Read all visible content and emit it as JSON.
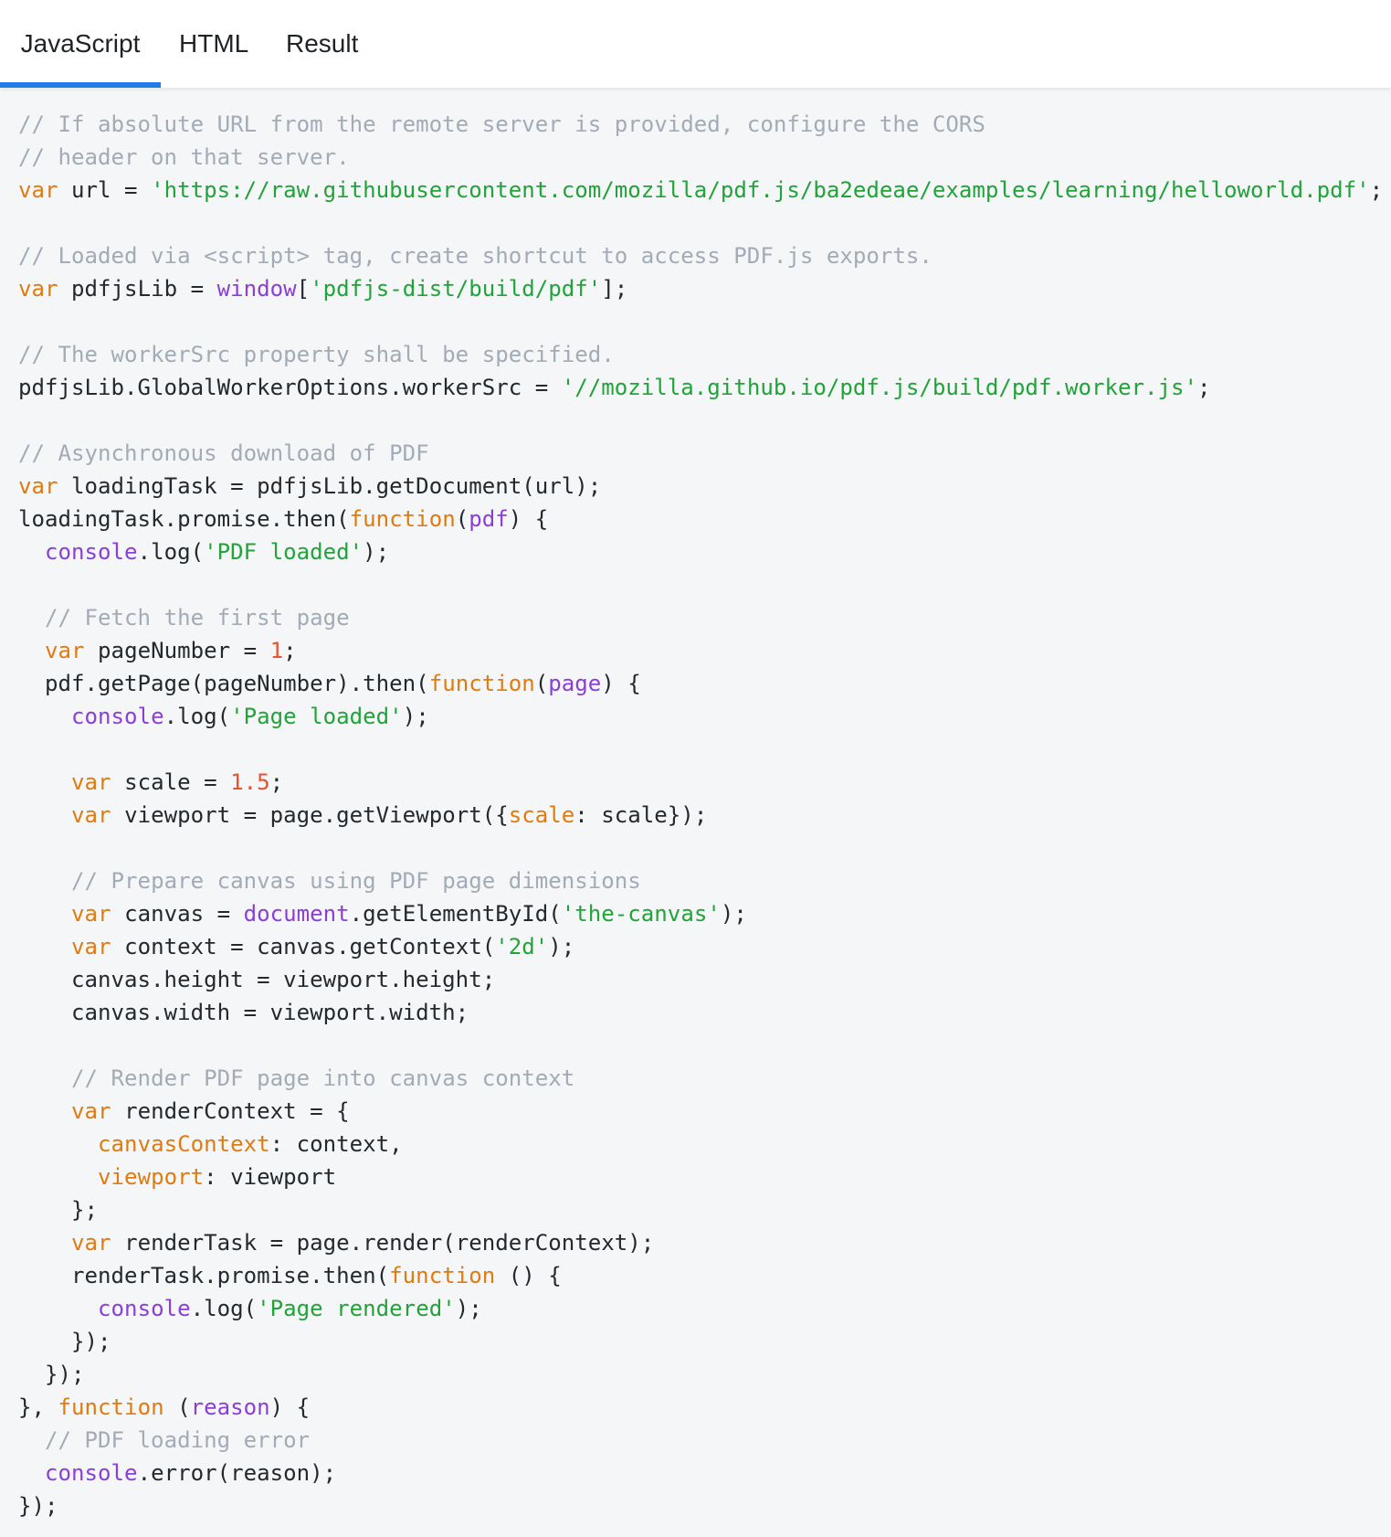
{
  "tabs": [
    {
      "label": "JavaScript",
      "active": true
    },
    {
      "label": "HTML",
      "active": false
    },
    {
      "label": "Result",
      "active": false
    }
  ],
  "colors": {
    "active_tab_underline": "#1e7ee6",
    "code_background": "#f5f6f8",
    "comment": "#a2abb6",
    "keyword": "#e07b10",
    "string": "#22a33a",
    "builtin": "#8b3fd6",
    "number": "#e8532b",
    "plain": "#24292e"
  },
  "code_lines": [
    [
      [
        "c",
        "// If absolute URL from the remote server is provided, configure the CORS"
      ]
    ],
    [
      [
        "c",
        "// header on that server."
      ]
    ],
    [
      [
        "k",
        "var"
      ],
      [
        "x",
        " url = "
      ],
      [
        "s",
        "'https://raw.githubusercontent.com/mozilla/pdf.js/ba2edeae/examples/learning/helloworld.pdf'"
      ],
      [
        "x",
        ";"
      ]
    ],
    [],
    [
      [
        "c",
        "// Loaded via <script> tag, create shortcut to access PDF.js exports."
      ]
    ],
    [
      [
        "k",
        "var"
      ],
      [
        "x",
        " pdfjsLib = "
      ],
      [
        "p",
        "window"
      ],
      [
        "x",
        "["
      ],
      [
        "s",
        "'pdfjs-dist/build/pdf'"
      ],
      [
        "x",
        "];"
      ]
    ],
    [],
    [
      [
        "c",
        "// The workerSrc property shall be specified."
      ]
    ],
    [
      [
        "x",
        "pdfjsLib.GlobalWorkerOptions.workerSrc = "
      ],
      [
        "s",
        "'//mozilla.github.io/pdf.js/build/pdf.worker.js'"
      ],
      [
        "x",
        ";"
      ]
    ],
    [],
    [
      [
        "c",
        "// Asynchronous download of PDF"
      ]
    ],
    [
      [
        "k",
        "var"
      ],
      [
        "x",
        " loadingTask = pdfjsLib.getDocument(url);"
      ]
    ],
    [
      [
        "x",
        "loadingTask.promise.then("
      ],
      [
        "k",
        "function"
      ],
      [
        "x",
        "("
      ],
      [
        "p",
        "pdf"
      ],
      [
        "x",
        ") {"
      ]
    ],
    [
      [
        "x",
        "  "
      ],
      [
        "p",
        "console"
      ],
      [
        "x",
        ".log("
      ],
      [
        "s",
        "'PDF loaded'"
      ],
      [
        "x",
        ");"
      ]
    ],
    [],
    [
      [
        "x",
        "  "
      ],
      [
        "c",
        "// Fetch the first page"
      ]
    ],
    [
      [
        "x",
        "  "
      ],
      [
        "k",
        "var"
      ],
      [
        "x",
        " pageNumber = "
      ],
      [
        "n",
        "1"
      ],
      [
        "x",
        ";"
      ]
    ],
    [
      [
        "x",
        "  pdf.getPage(pageNumber).then("
      ],
      [
        "k",
        "function"
      ],
      [
        "x",
        "("
      ],
      [
        "p",
        "page"
      ],
      [
        "x",
        ") {"
      ]
    ],
    [
      [
        "x",
        "    "
      ],
      [
        "p",
        "console"
      ],
      [
        "x",
        ".log("
      ],
      [
        "s",
        "'Page loaded'"
      ],
      [
        "x",
        ");"
      ]
    ],
    [],
    [
      [
        "x",
        "    "
      ],
      [
        "k",
        "var"
      ],
      [
        "x",
        " scale = "
      ],
      [
        "n",
        "1.5"
      ],
      [
        "x",
        ";"
      ]
    ],
    [
      [
        "x",
        "    "
      ],
      [
        "k",
        "var"
      ],
      [
        "x",
        " viewport = page.getViewport({"
      ],
      [
        "o",
        "scale"
      ],
      [
        "x",
        ": scale});"
      ]
    ],
    [],
    [
      [
        "x",
        "    "
      ],
      [
        "c",
        "// Prepare canvas using PDF page dimensions"
      ]
    ],
    [
      [
        "x",
        "    "
      ],
      [
        "k",
        "var"
      ],
      [
        "x",
        " canvas = "
      ],
      [
        "p",
        "document"
      ],
      [
        "x",
        ".getElementById("
      ],
      [
        "s",
        "'the-canvas'"
      ],
      [
        "x",
        ");"
      ]
    ],
    [
      [
        "x",
        "    "
      ],
      [
        "k",
        "var"
      ],
      [
        "x",
        " context = canvas.getContext("
      ],
      [
        "s",
        "'2d'"
      ],
      [
        "x",
        ");"
      ]
    ],
    [
      [
        "x",
        "    canvas.height = viewport.height;"
      ]
    ],
    [
      [
        "x",
        "    canvas.width = viewport.width;"
      ]
    ],
    [],
    [
      [
        "x",
        "    "
      ],
      [
        "c",
        "// Render PDF page into canvas context"
      ]
    ],
    [
      [
        "x",
        "    "
      ],
      [
        "k",
        "var"
      ],
      [
        "x",
        " renderContext = {"
      ]
    ],
    [
      [
        "x",
        "      "
      ],
      [
        "o",
        "canvasContext"
      ],
      [
        "x",
        ": context,"
      ]
    ],
    [
      [
        "x",
        "      "
      ],
      [
        "o",
        "viewport"
      ],
      [
        "x",
        ": viewport"
      ]
    ],
    [
      [
        "x",
        "    };"
      ]
    ],
    [
      [
        "x",
        "    "
      ],
      [
        "k",
        "var"
      ],
      [
        "x",
        " renderTask = page.render(renderContext);"
      ]
    ],
    [
      [
        "x",
        "    renderTask.promise.then("
      ],
      [
        "k",
        "function"
      ],
      [
        "x",
        " () {"
      ]
    ],
    [
      [
        "x",
        "      "
      ],
      [
        "p",
        "console"
      ],
      [
        "x",
        ".log("
      ],
      [
        "s",
        "'Page rendered'"
      ],
      [
        "x",
        ");"
      ]
    ],
    [
      [
        "x",
        "    });"
      ]
    ],
    [
      [
        "x",
        "  });"
      ]
    ],
    [
      [
        "x",
        "}, "
      ],
      [
        "k",
        "function"
      ],
      [
        "x",
        " ("
      ],
      [
        "p",
        "reason"
      ],
      [
        "x",
        ") {"
      ]
    ],
    [
      [
        "x",
        "  "
      ],
      [
        "c",
        "// PDF loading error"
      ]
    ],
    [
      [
        "x",
        "  "
      ],
      [
        "p",
        "console"
      ],
      [
        "x",
        ".error(reason);"
      ]
    ],
    [
      [
        "x",
        "});"
      ]
    ]
  ]
}
